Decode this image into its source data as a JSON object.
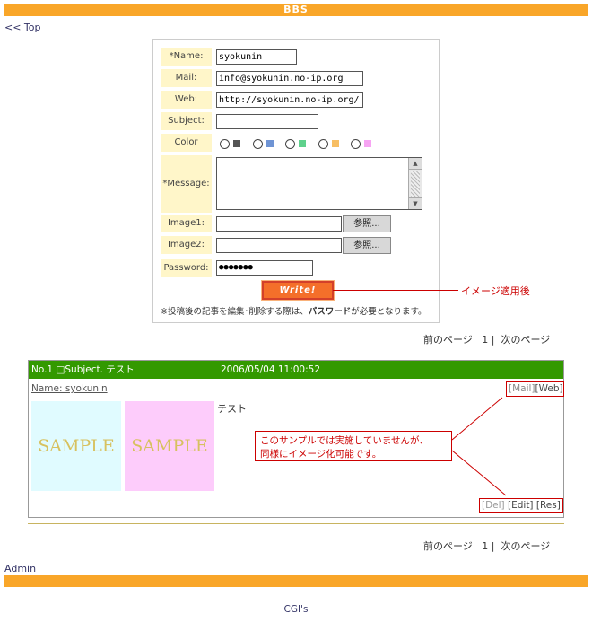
{
  "header": {
    "title": "BBS"
  },
  "nav": {
    "top_link": "<< Top"
  },
  "form": {
    "name_label": "*Name:",
    "name_value": "syokunin",
    "mail_label": "Mail:",
    "mail_value": "info@syokunin.no-ip.org",
    "web_label": "Web:",
    "web_value": "http://syokunin.no-ip.org/",
    "subject_label": "Subject:",
    "subject_value": "",
    "color_label": "Color",
    "colors": [
      "#555555",
      "#6f94d4",
      "#5fd18c",
      "#f7be63",
      "#f7a4f3"
    ],
    "message_label": "*Message:",
    "image1_label": "Image1:",
    "image2_label": "Image2:",
    "browse_label": "参照...",
    "password_label": "Password:",
    "password_value": "●●●●●●●",
    "write_label": "Write!",
    "note_prefix": "※投稿後の記事を編集･削除する際は、",
    "note_bold": "パスワード",
    "note_suffix": "が必要となります。"
  },
  "annotations": {
    "image_applied": "イメージ適用後",
    "callout_line1": "このサンプルでは実施していませんが、",
    "callout_line2": "同様にイメージ化可能です。"
  },
  "pager": {
    "prev": "前のページ",
    "page": "1",
    "sep": "|",
    "next": "次のページ"
  },
  "post": {
    "header_left": "No.1 □Subject. テスト",
    "date": "2006/05/04 11:00:52",
    "name": "Name: syokunin",
    "mail_link": "[Mail]",
    "web_link": "[Web]",
    "image1_text": "SAMPLE",
    "image2_text": "SAMPLE",
    "message": "テスト",
    "del_link": "[Del]",
    "edit_link": "[Edit]",
    "res_link": "[Res]"
  },
  "footer": {
    "admin": "Admin",
    "cgis": "CGI's"
  }
}
